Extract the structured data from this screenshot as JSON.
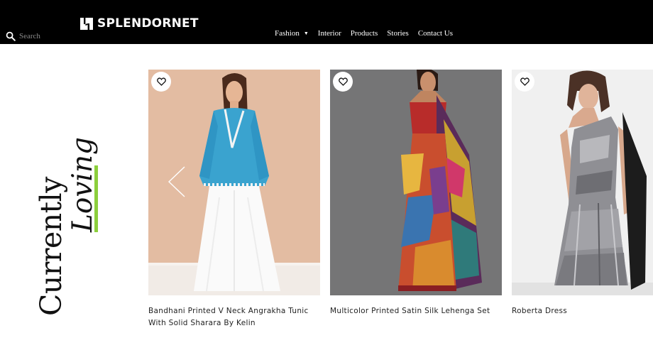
{
  "header": {
    "search_placeholder": "Search",
    "brand": "SPLENDORNET",
    "nav": [
      {
        "label": "Fashion",
        "has_dropdown": true
      },
      {
        "label": "Interior"
      },
      {
        "label": "Products"
      },
      {
        "label": "Stories"
      },
      {
        "label": "Contact Us"
      }
    ]
  },
  "section": {
    "title_line_1": "Currently",
    "title_line_2": "Loving",
    "accent_color": "#8ccf3c"
  },
  "products": [
    {
      "name": "Bandhani Printed V Neck Angrakha Tunic With Solid Sharara By Kelin"
    },
    {
      "name": "Multicolor Printed Satin Silk Lehenga Set"
    },
    {
      "name": "Roberta Dress"
    }
  ],
  "icons": {
    "search": "search-icon",
    "wishlist": "heart-icon",
    "carousel_prev": "chevron-left-icon",
    "nav_dropdown": "caret-down-icon"
  },
  "colors": {
    "header_bg": "#000000",
    "header_text": "#ffffff"
  }
}
